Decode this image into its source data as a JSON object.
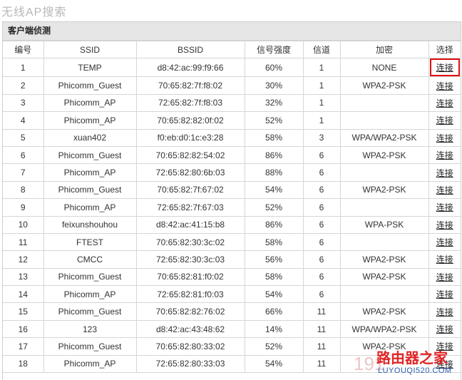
{
  "page_title": "无线AP搜索",
  "panel": {
    "header": "客户端侦测",
    "columns": [
      "编号",
      "SSID",
      "BSSID",
      "信号强度",
      "信道",
      "加密",
      "选择"
    ],
    "rows": [
      {
        "no": "1",
        "ssid": "TEMP",
        "bssid": "d8:42:ac:99:f9:66",
        "signal": "60%",
        "channel": "1",
        "encryption": "NONE",
        "action": "连接"
      },
      {
        "no": "2",
        "ssid": "Phicomm_Guest",
        "bssid": "70:65:82:7f:f8:02",
        "signal": "30%",
        "channel": "1",
        "encryption": "WPA2-PSK",
        "action": "连接"
      },
      {
        "no": "3",
        "ssid": "Phicomm_AP",
        "bssid": "72:65:82:7f:f8:03",
        "signal": "32%",
        "channel": "1",
        "encryption": "",
        "action": "连接"
      },
      {
        "no": "4",
        "ssid": "Phicomm_AP",
        "bssid": "70:65:82:82:0f:02",
        "signal": "52%",
        "channel": "1",
        "encryption": "",
        "action": "连接"
      },
      {
        "no": "5",
        "ssid": "xuan402",
        "bssid": "f0:eb:d0:1c:e3:28",
        "signal": "58%",
        "channel": "3",
        "encryption": "WPA/WPA2-PSK",
        "action": "连接"
      },
      {
        "no": "6",
        "ssid": "Phicomm_Guest",
        "bssid": "70:65:82:82:54:02",
        "signal": "86%",
        "channel": "6",
        "encryption": "WPA2-PSK",
        "action": "连接"
      },
      {
        "no": "7",
        "ssid": "Phicomm_AP",
        "bssid": "72:65:82:80:6b:03",
        "signal": "88%",
        "channel": "6",
        "encryption": "",
        "action": "连接"
      },
      {
        "no": "8",
        "ssid": "Phicomm_Guest",
        "bssid": "70:65:82:7f:67:02",
        "signal": "54%",
        "channel": "6",
        "encryption": "WPA2-PSK",
        "action": "连接"
      },
      {
        "no": "9",
        "ssid": "Phicomm_AP",
        "bssid": "72:65:82:7f:67:03",
        "signal": "52%",
        "channel": "6",
        "encryption": "",
        "action": "连接"
      },
      {
        "no": "10",
        "ssid": "feixunshouhou",
        "bssid": "d8:42:ac:41:15:b8",
        "signal": "86%",
        "channel": "6",
        "encryption": "WPA-PSK",
        "action": "连接"
      },
      {
        "no": "11",
        "ssid": "FTEST",
        "bssid": "70:65:82:30:3c:02",
        "signal": "58%",
        "channel": "6",
        "encryption": "",
        "action": "连接"
      },
      {
        "no": "12",
        "ssid": "CMCC",
        "bssid": "72:65:82:30:3c:03",
        "signal": "56%",
        "channel": "6",
        "encryption": "WPA2-PSK",
        "action": "连接"
      },
      {
        "no": "13",
        "ssid": "Phicomm_Guest",
        "bssid": "70:65:82:81:f0:02",
        "signal": "58%",
        "channel": "6",
        "encryption": "WPA2-PSK",
        "action": "连接"
      },
      {
        "no": "14",
        "ssid": "Phicomm_AP",
        "bssid": "72:65:82:81:f0:03",
        "signal": "54%",
        "channel": "6",
        "encryption": "",
        "action": "连接"
      },
      {
        "no": "15",
        "ssid": "Phicomm_Guest",
        "bssid": "70:65:82:82:76:02",
        "signal": "66%",
        "channel": "11",
        "encryption": "WPA2-PSK",
        "action": "连接"
      },
      {
        "no": "16",
        "ssid": "123",
        "bssid": "d8:42:ac:43:48:62",
        "signal": "14%",
        "channel": "11",
        "encryption": "WPA/WPA2-PSK",
        "action": "连接"
      },
      {
        "no": "17",
        "ssid": "Phicomm_Guest",
        "bssid": "70:65:82:80:33:02",
        "signal": "52%",
        "channel": "11",
        "encryption": "WPA2-PSK",
        "action": "连接"
      },
      {
        "no": "18",
        "ssid": "Phicomm_AP",
        "bssid": "72:65:82:80:33:03",
        "signal": "54%",
        "channel": "11",
        "encryption": "",
        "action": "连接"
      }
    ]
  },
  "highlighted_row_no": "1",
  "highlight_color": "#e01010",
  "watermark": {
    "number": "191",
    "site_name": "路由器之家",
    "url": "LUYOUQI520.COM"
  }
}
